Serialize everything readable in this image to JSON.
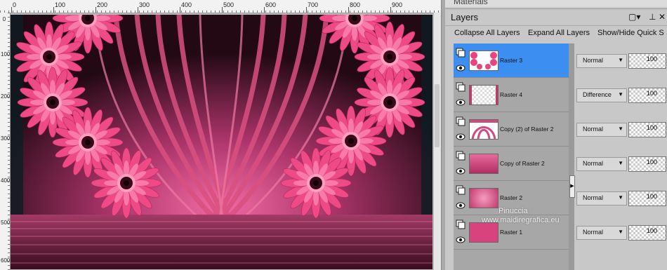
{
  "app": {
    "panel_title": "Layers",
    "materials_title": "Materials"
  },
  "ruler": {
    "top_labels": [
      "0",
      "100",
      "200",
      "300",
      "400",
      "500",
      "600",
      "700",
      "800",
      "900"
    ],
    "left_labels": [
      "0",
      "100",
      "200",
      "300",
      "400",
      "500",
      "600"
    ]
  },
  "toolbar": {
    "collapse": "Collapse All Layers",
    "expand": "Expand All Layers",
    "show_hide": "Show/Hide Quick S"
  },
  "layers": [
    {
      "name": "Raster 3",
      "blend": "Normal",
      "opacity": "100",
      "selected": true
    },
    {
      "name": "Raster 4",
      "blend": "Difference",
      "opacity": "100",
      "selected": false
    },
    {
      "name": "Copy (2) of Raster 2",
      "blend": "Normal",
      "opacity": "100",
      "selected": false
    },
    {
      "name": "Copy of Raster 2",
      "blend": "Normal",
      "opacity": "100",
      "selected": false
    },
    {
      "name": "Raster 2",
      "blend": "Normal",
      "opacity": "100",
      "selected": false
    },
    {
      "name": "Raster 1",
      "blend": "Normal",
      "opacity": "100",
      "selected": false
    }
  ],
  "watermark": {
    "line1": "Pinuccia",
    "line2": "www.maidiregrafica.eu"
  },
  "colors": {
    "selected": "#3c8ff0",
    "flower": "#f0558a",
    "background": "#c8c8c8"
  }
}
